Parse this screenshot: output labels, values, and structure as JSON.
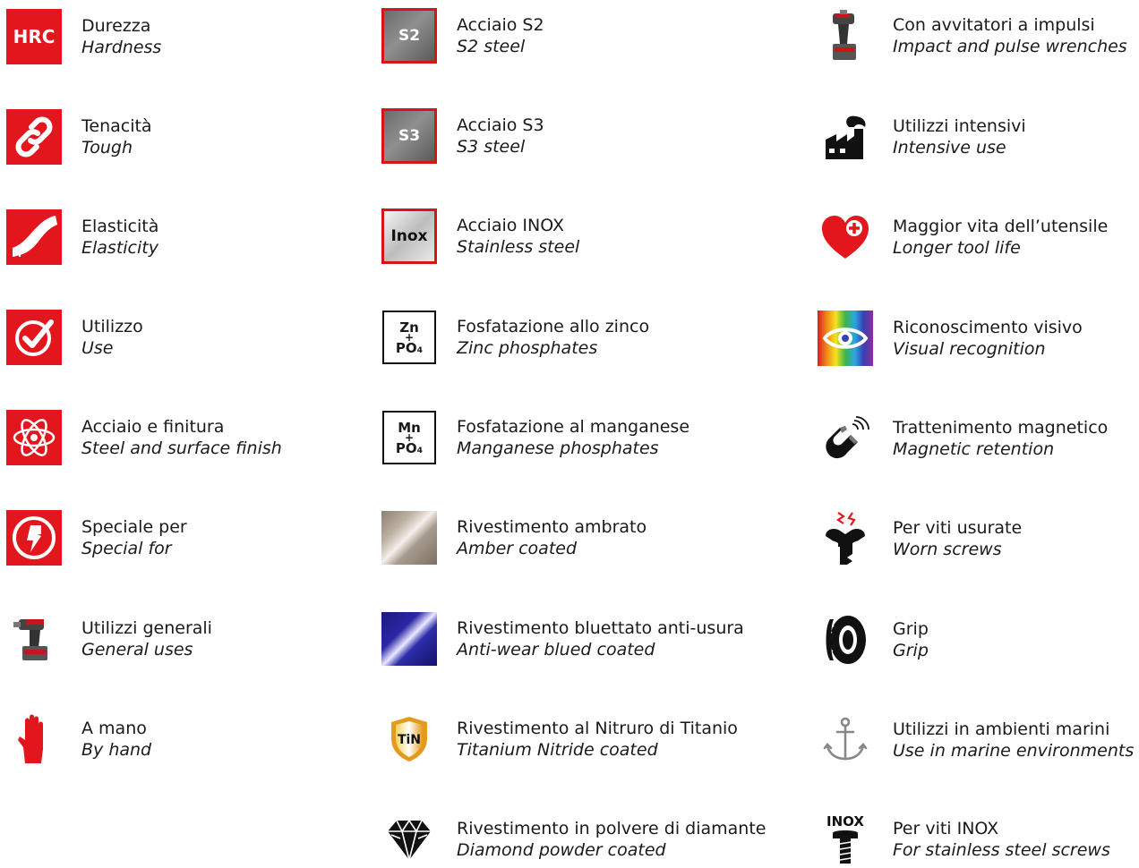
{
  "column1": [
    {
      "label": "Durezza",
      "label_en": "Hardness",
      "icon": "hrc-icon",
      "icon_text": "HRC"
    },
    {
      "label": "Tenacità",
      "label_en": "Tough",
      "icon": "chain-link-icon"
    },
    {
      "label": "Elasticità",
      "label_en": "Elasticity",
      "icon": "bending-bar-icon"
    },
    {
      "label": "Utilizzo",
      "label_en": "Use",
      "icon": "checkmark-circle-icon"
    },
    {
      "label": "Acciaio e finitura",
      "label_en": "Steel and surface finish",
      "icon": "atom-icon"
    },
    {
      "label": "Speciale per",
      "label_en": "Special for",
      "icon": "lightning-fist-icon"
    },
    {
      "label": "Utilizzi generali",
      "label_en": "General uses",
      "icon": "cordless-drill-icon"
    },
    {
      "label": "A mano",
      "label_en": "By hand",
      "icon": "hand-icon"
    }
  ],
  "column2": [
    {
      "label": "Acciaio S2",
      "label_en": "S2 steel",
      "icon": "steel-s2-icon",
      "icon_text": "S2"
    },
    {
      "label": "Acciaio S3",
      "label_en": "S3 steel",
      "icon": "steel-s3-icon",
      "icon_text": "S3"
    },
    {
      "label": "Acciaio INOX",
      "label_en": "Stainless steel",
      "icon": "steel-inox-icon",
      "icon_text": "Inox"
    },
    {
      "label": "Fosfatazione allo zinco",
      "label_en": "Zinc phosphates",
      "icon": "zinc-phosphate-icon",
      "icon_text_top": "Zn",
      "icon_text_plus": "+",
      "icon_text_bottom": "PO₄"
    },
    {
      "label": "Fosfatazione al manganese",
      "label_en": "Manganese phosphates",
      "icon": "manganese-phosphate-icon",
      "icon_text_top": "Mn",
      "icon_text_plus": "+",
      "icon_text_bottom": "PO₄"
    },
    {
      "label": "Rivestimento ambrato",
      "label_en": "Amber coated",
      "icon": "amber-swatch-icon"
    },
    {
      "label": "Rivestimento bluettato anti-usura",
      "label_en": "Anti-wear blued coated",
      "icon": "blue-swatch-icon"
    },
    {
      "label": "Rivestimento al Nitruro di Titanio",
      "label_en": "Titanium Nitride coated",
      "icon": "tin-shield-icon",
      "icon_text": "TiN"
    },
    {
      "label": "Rivestimento in polvere di diamante",
      "label_en": "Diamond powder coated",
      "icon": "diamond-icon"
    }
  ],
  "column3": [
    {
      "label": "Con avvitatori a impulsi",
      "label_en": "Impact and pulse wrenches",
      "icon": "impact-wrench-icon"
    },
    {
      "label": "Utilizzi intensivi",
      "label_en": "Intensive use",
      "icon": "factory-icon"
    },
    {
      "label": "Maggior vita dell’utensile",
      "label_en": "Longer tool life",
      "icon": "heart-plus-icon"
    },
    {
      "label": "Riconoscimento visivo",
      "label_en": "Visual recognition",
      "icon": "rainbow-eye-icon"
    },
    {
      "label": "Trattenimento magnetico",
      "label_en": "Magnetic retention",
      "icon": "magnet-icon"
    },
    {
      "label": "Per viti usurate",
      "label_en": "Worn screws",
      "icon": "worn-screw-icon"
    },
    {
      "label": "Grip",
      "label_en": "Grip",
      "icon": "tire-icon"
    },
    {
      "label": "Utilizzi in ambienti marini",
      "label_en": "Use in marine environments",
      "icon": "anchor-icon"
    },
    {
      "label": "Per viti INOX",
      "label_en": "For stainless steel screws",
      "icon": "inox-screw-icon",
      "icon_text": "INOX"
    }
  ],
  "colors": {
    "brand_red": "#e3151d",
    "dark": "#1a1a1a"
  }
}
